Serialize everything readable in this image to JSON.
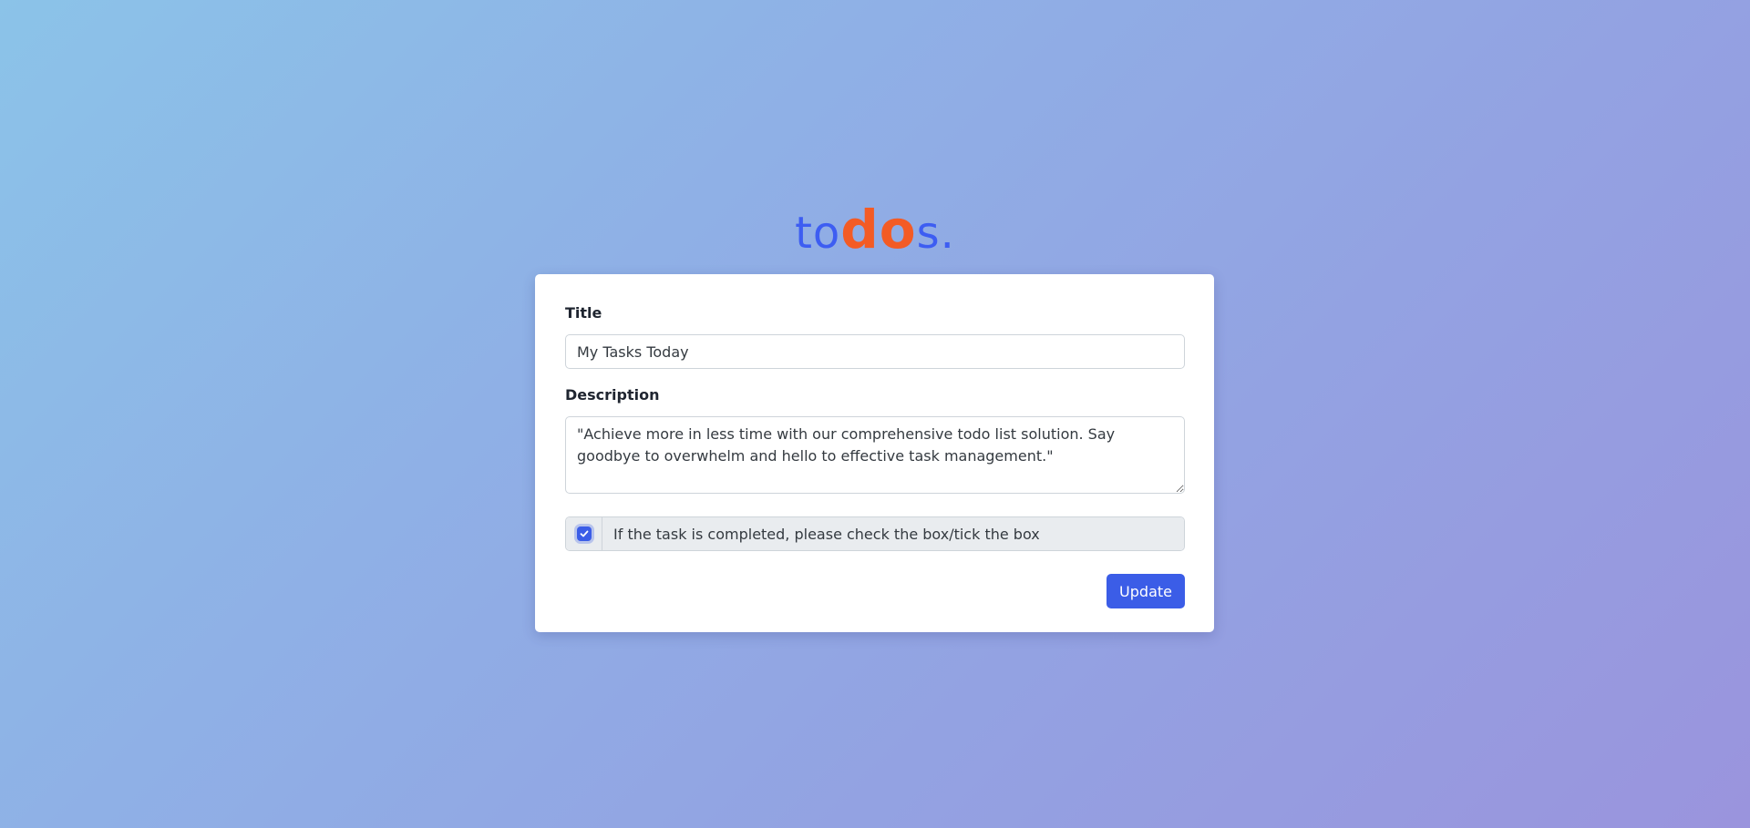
{
  "logo": {
    "prefix": "to",
    "highlight": "do",
    "suffix": "s."
  },
  "form": {
    "title_label": "Title",
    "title_value": "My Tasks Today",
    "description_label": "Description",
    "description_value": "\"Achieve more in less time with our comprehensive todo list solution. Say goodbye to overwhelm and hello to effective task management.\"",
    "completed_checked": true,
    "completed_label": "If the task is completed, please check the box/tick the box",
    "submit_label": "Update"
  },
  "colors": {
    "accent": "#3b5de7",
    "logo_highlight": "#f35b25",
    "logo_text": "#3d5df2"
  },
  "icons": {
    "checkbox": "check-icon"
  }
}
